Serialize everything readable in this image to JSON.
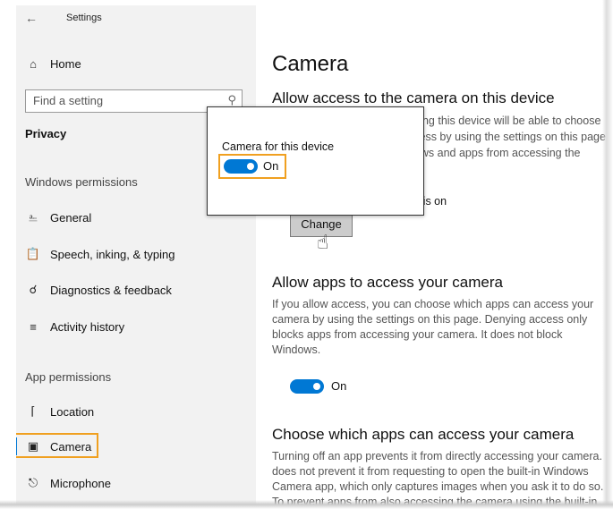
{
  "window": {
    "title": "Settings",
    "back_icon": "back-arrow-icon"
  },
  "sidebar": {
    "home": {
      "label": "Home",
      "icon": "home-icon"
    },
    "search": {
      "placeholder": "Find a setting",
      "icon": "search-icon"
    },
    "category": "Privacy",
    "windows_permissions_header": "Windows permissions",
    "windows_items": [
      {
        "label": "General",
        "icon": "lock-icon"
      },
      {
        "label": "Speech, inking, & typing",
        "icon": "clipboard-icon"
      },
      {
        "label": "Diagnostics & feedback",
        "icon": "feedback-icon"
      },
      {
        "label": "Activity history",
        "icon": "timeline-icon"
      }
    ],
    "app_permissions_header": "App permissions",
    "app_items": [
      {
        "label": "Location",
        "icon": "location-icon"
      },
      {
        "label": "Camera",
        "icon": "camera-icon",
        "selected": true
      },
      {
        "label": "Microphone",
        "icon": "microphone-icon"
      }
    ]
  },
  "main": {
    "title": "Camera",
    "device_section": {
      "heading": "Allow access to the camera on this device",
      "text_line1": "using this device will be able to choose",
      "text_line2": "ccess by using the settings on this page.",
      "text_line3": "dows and apps from accessing the",
      "status_fragment": "ce is on",
      "change_button": "Change"
    },
    "apps_section": {
      "heading": "Allow apps to access your camera",
      "text": "If you allow access, you can choose which apps can access your camera by using the settings on this page. Denying access only blocks apps from accessing your camera. It does not block Windows.",
      "toggle_state": "On"
    },
    "choose_section": {
      "heading": "Choose which apps can access your camera",
      "text": "Turning off an app prevents it from directly accessing your camera. It does not prevent it from requesting to open the built-in Windows Camera app, which only captures images when you ask it to do so. To prevent apps from also accessing the camera using the built-in"
    }
  },
  "popup": {
    "label": "Camera for this device",
    "toggle_state": "On"
  },
  "colors": {
    "accent": "#0078d4",
    "highlight": "#f0a020",
    "sidebar_bg": "#f2f2f2"
  }
}
